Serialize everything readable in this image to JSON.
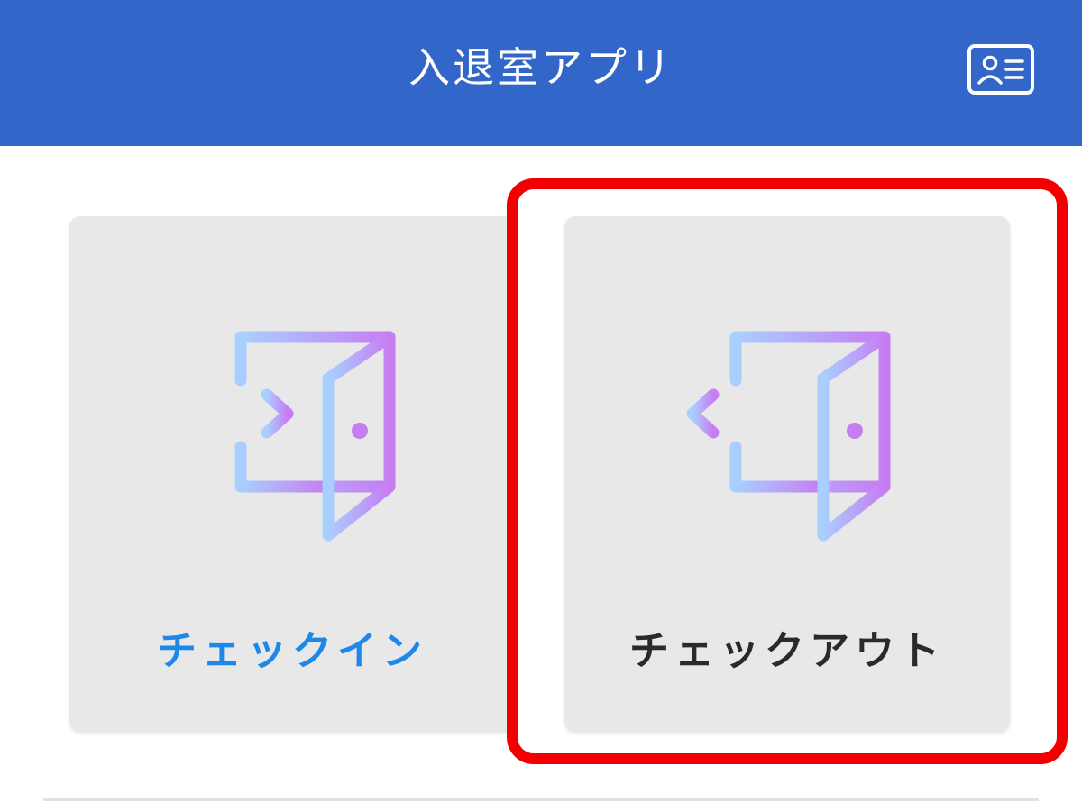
{
  "header": {
    "title": "入退室アプリ",
    "background_color": "#3366c9",
    "id_card_icon": "id-card-icon"
  },
  "tiles": [
    {
      "label": "チェックイン",
      "icon": "enter-door-icon",
      "label_color": "#1e88ea",
      "highlighted": false
    },
    {
      "label": "チェックアウト",
      "icon": "exit-door-icon",
      "label_color": "#2a2a2a",
      "highlighted": true
    }
  ],
  "highlight_color": "#f20000"
}
